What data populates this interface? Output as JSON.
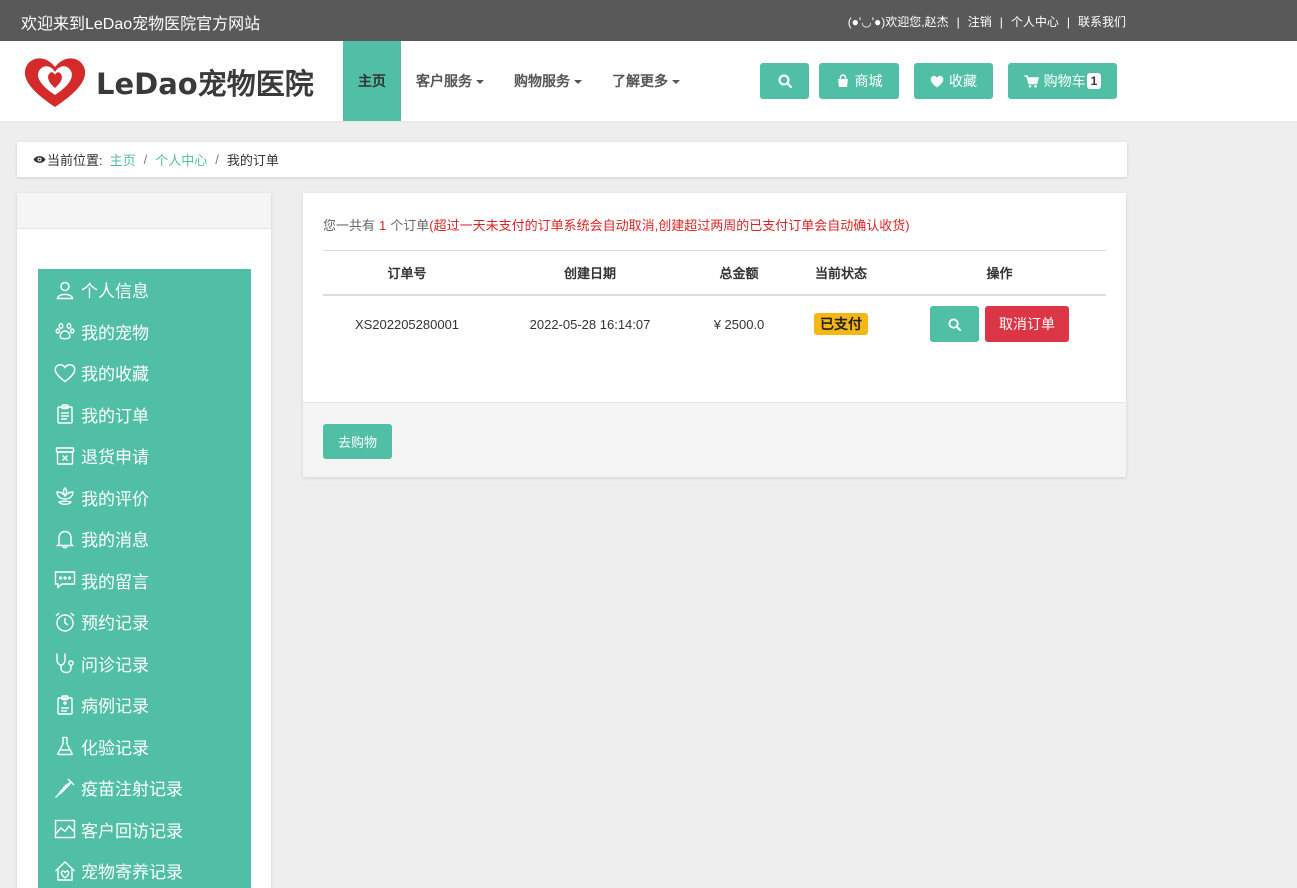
{
  "topbar": {
    "welcome": "欢迎来到LeDao宠物医院官方网站",
    "greeting": "(●'◡'●)欢迎您,赵杰",
    "logout": "注销",
    "profile": "个人中心",
    "contact": "联系我们",
    "separator": "|"
  },
  "header": {
    "logo_text": "LeDao宠物医院",
    "nav": [
      {
        "label": "主页",
        "active": true
      },
      {
        "label": "客户服务",
        "dropdown": true
      },
      {
        "label": "购物服务",
        "dropdown": true
      },
      {
        "label": "了解更多",
        "dropdown": true
      }
    ],
    "buttons": {
      "search_icon": "search-icon",
      "mall": "商城",
      "favorites": "收藏",
      "cart": "购物车",
      "cart_count": "1"
    },
    "accent": "#51bfa5"
  },
  "breadcrumb": {
    "label": "当前位置:",
    "home": "主页",
    "center": "个人中心",
    "current": "我的订单",
    "sep": "/"
  },
  "sidebar": {
    "items": [
      {
        "label": "个人信息",
        "icon": "user-icon"
      },
      {
        "label": "我的宠物",
        "icon": "paw-icon"
      },
      {
        "label": "我的收藏",
        "icon": "heart-icon"
      },
      {
        "label": "我的订单",
        "icon": "clipboard-icon"
      },
      {
        "label": "退货申请",
        "icon": "return-box-icon"
      },
      {
        "label": "我的评价",
        "icon": "flower-icon"
      },
      {
        "label": "我的消息",
        "icon": "bell-icon"
      },
      {
        "label": "我的留言",
        "icon": "chat-icon"
      },
      {
        "label": "预约记录",
        "icon": "alarm-clock-icon"
      },
      {
        "label": "问诊记录",
        "icon": "stethoscope-icon"
      },
      {
        "label": "病例记录",
        "icon": "medical-record-icon"
      },
      {
        "label": "化验记录",
        "icon": "flask-icon"
      },
      {
        "label": "疫苗注射记录",
        "icon": "syringe-icon"
      },
      {
        "label": "客户回访记录",
        "icon": "chart-icon"
      },
      {
        "label": "宠物寄养记录",
        "icon": "house-icon"
      }
    ]
  },
  "orders": {
    "summary_prefix": "您一共有",
    "count": "1",
    "summary_suffix": "个订单",
    "notice": "(超过一天未支付的订单系统会自动取消,创建超过两周的已支付订单会自动确认收货)",
    "columns": [
      "订单号",
      "创建日期",
      "总金额",
      "当前状态",
      "操作"
    ],
    "rows": [
      {
        "id": "XS202205280001",
        "date": "2022-05-28 16:14:07",
        "total": "¥ 2500.0",
        "status": "已支付",
        "cancel": "取消订单"
      }
    ],
    "go_shopping": "去购物",
    "status_color": "#f5b716",
    "cancel_color": "#dc3545"
  }
}
